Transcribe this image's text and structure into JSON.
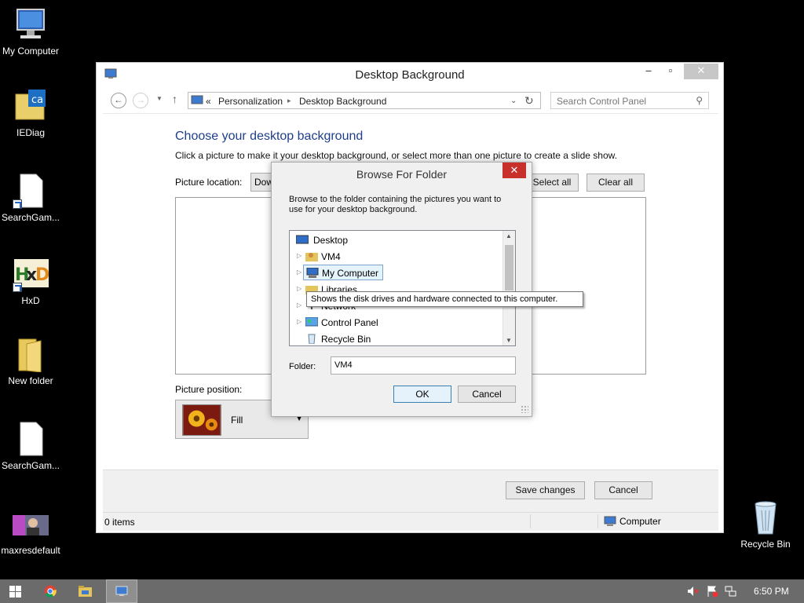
{
  "desktop": {
    "icons": [
      {
        "label": "My Computer"
      },
      {
        "label": "IEDiag"
      },
      {
        "label": "SearchGam..."
      },
      {
        "label": "HxD"
      },
      {
        "label": "New folder"
      },
      {
        "label": "SearchGam..."
      },
      {
        "label": "maxresdefault"
      },
      {
        "label": "Recycle Bin"
      }
    ]
  },
  "window": {
    "title": "Desktop Background",
    "controls": {
      "minimize": "–",
      "maximize": "▫",
      "close": "✕"
    },
    "address": {
      "chevrons": "«",
      "crumbs": [
        "Personalization",
        "Desktop Background"
      ],
      "separator": "▸"
    },
    "search": {
      "placeholder": "Search Control Panel"
    },
    "heading": "Choose your desktop background",
    "description": "Click a picture to make it your desktop background, or select more than one picture to create a slide show.",
    "picture_location_label": "Picture location:",
    "picture_location_value": "Dow",
    "select_all": "Select all",
    "clear_all": "Clear all",
    "picture_position_label": "Picture position:",
    "picture_position_value": "Fill",
    "save_changes": "Save changes",
    "cancel": "Cancel",
    "status": {
      "items": "0 items",
      "location": "Computer"
    }
  },
  "dialog": {
    "title": "Browse For Folder",
    "close": "✕",
    "description": "Browse to the folder containing the pictures you want to use for your desktop background.",
    "tree": [
      {
        "label": "Desktop",
        "icon": "desktop-icon"
      },
      {
        "label": "VM4",
        "icon": "user-folder-icon"
      },
      {
        "label": "My Computer",
        "icon": "computer-icon",
        "selected": true
      },
      {
        "label": "Libraries",
        "icon": "libraries-icon"
      },
      {
        "label": "Network",
        "icon": "network-icon"
      },
      {
        "label": "Control Panel",
        "icon": "control-panel-icon"
      },
      {
        "label": "Recycle Bin",
        "icon": "recycle-bin-icon"
      }
    ],
    "tooltip": "Shows the disk drives and hardware connected to this computer.",
    "folder_label": "Folder:",
    "folder_value": "VM4",
    "ok": "OK",
    "cancel": "Cancel"
  },
  "taskbar": {
    "clock": "6:50 PM"
  },
  "colors": {
    "heading_blue": "#1e3f8c",
    "close_red": "#c7302b",
    "taskbar": "#6b6b6b"
  }
}
